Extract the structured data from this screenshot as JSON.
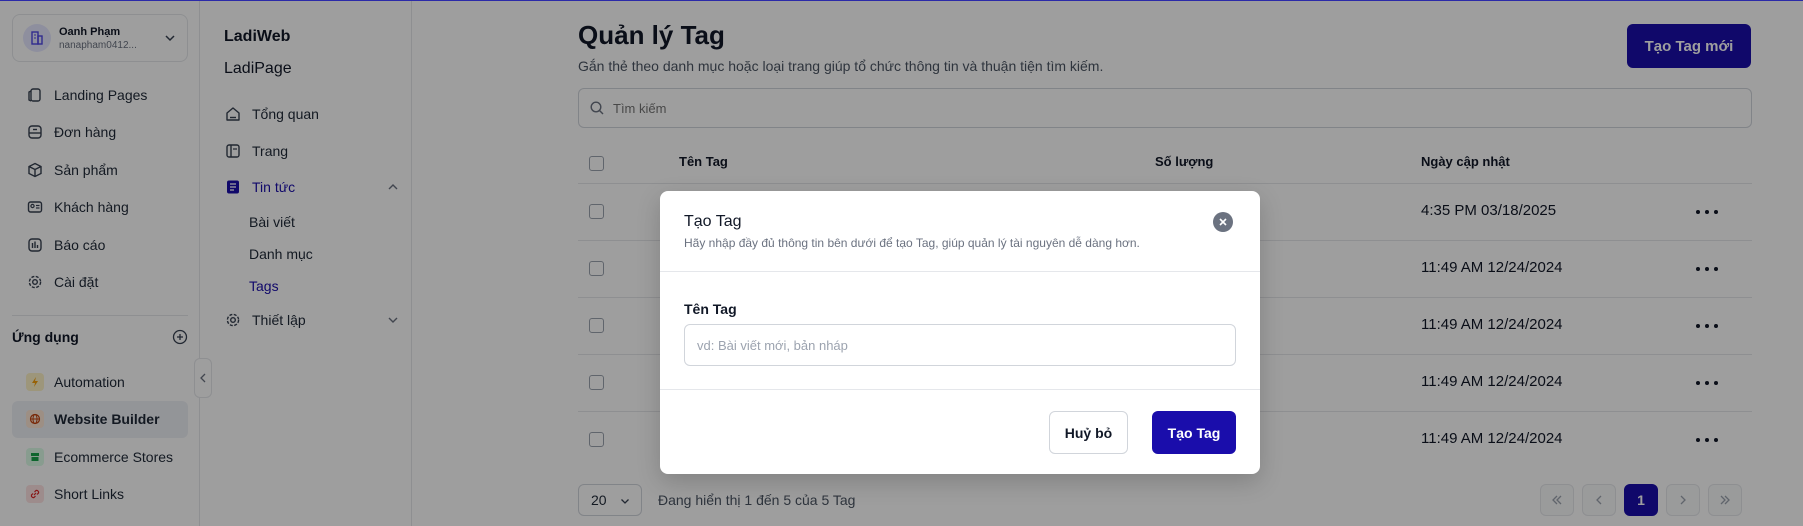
{
  "account": {
    "name": "Oanh Phạm",
    "email": "nanapham0412..."
  },
  "sidebar": {
    "items": [
      {
        "label": "Landing Pages",
        "icon": "landing-pages-icon"
      },
      {
        "label": "Đơn hàng",
        "icon": "orders-icon"
      },
      {
        "label": "Sản phẩm",
        "icon": "products-icon"
      },
      {
        "label": "Khách hàng",
        "icon": "customers-icon"
      },
      {
        "label": "Báo cáo",
        "icon": "reports-icon"
      },
      {
        "label": "Cài đặt",
        "icon": "settings-icon"
      }
    ],
    "apps_title": "Ứng dụng",
    "apps": [
      {
        "label": "Automation",
        "icon": "automation-icon",
        "color": "#f59e0b"
      },
      {
        "label": "Website Builder",
        "icon": "website-builder-icon",
        "color": "#c2410c",
        "active": true
      },
      {
        "label": "Ecommerce Stores",
        "icon": "ecommerce-icon",
        "color": "#16a34a"
      },
      {
        "label": "Short Links",
        "icon": "short-links-icon",
        "color": "#dc2626"
      }
    ]
  },
  "subnav": {
    "title1": "LadiWeb",
    "title2": "LadiPage",
    "items": [
      {
        "label": "Tổng quan",
        "icon": "home-icon"
      },
      {
        "label": "Trang",
        "icon": "page-icon"
      },
      {
        "label": "Tin tức",
        "icon": "news-icon",
        "active": true
      },
      {
        "label": "Thiết lập",
        "icon": "gear-icon"
      }
    ],
    "children": [
      {
        "label": "Bài viết"
      },
      {
        "label": "Danh mục"
      },
      {
        "label": "Tags",
        "active": true
      }
    ]
  },
  "main": {
    "title": "Quản lý Tag",
    "subtitle": "Gắn thẻ theo danh mục hoặc loại trang giúp tổ chức thông tin và thuận tiện tìm kiếm.",
    "new_button": "Tạo Tag mới",
    "search_placeholder": "Tìm kiếm",
    "columns": [
      "Tên Tag",
      "Số lượng",
      "Ngày cập nhật"
    ],
    "rows": [
      {
        "date": "4:35 PM 03/18/2025"
      },
      {
        "date": "11:49 AM 12/24/2024"
      },
      {
        "date": "11:49 AM 12/24/2024"
      },
      {
        "date": "11:49 AM 12/24/2024"
      },
      {
        "date": "11:49 AM 12/24/2024"
      }
    ],
    "page_size": "20",
    "showing": "Đang hiển thị 1 đến 5 của 5 Tag",
    "current_page": "1"
  },
  "modal": {
    "title": "Tạo Tag",
    "subtitle": "Hãy nhập đầy đủ thông tin bên dưới để tạo Tag, giúp quản lý tài nguyên dễ dàng hơn.",
    "label": "Tên Tag",
    "placeholder": "vd: Bài viết mới, bản nháp",
    "cancel": "Huỷ bỏ",
    "submit": "Tạo Tag"
  },
  "colors": {
    "accent": "#1a0dab",
    "overlay": "rgba(0,0,0,0.38)"
  }
}
